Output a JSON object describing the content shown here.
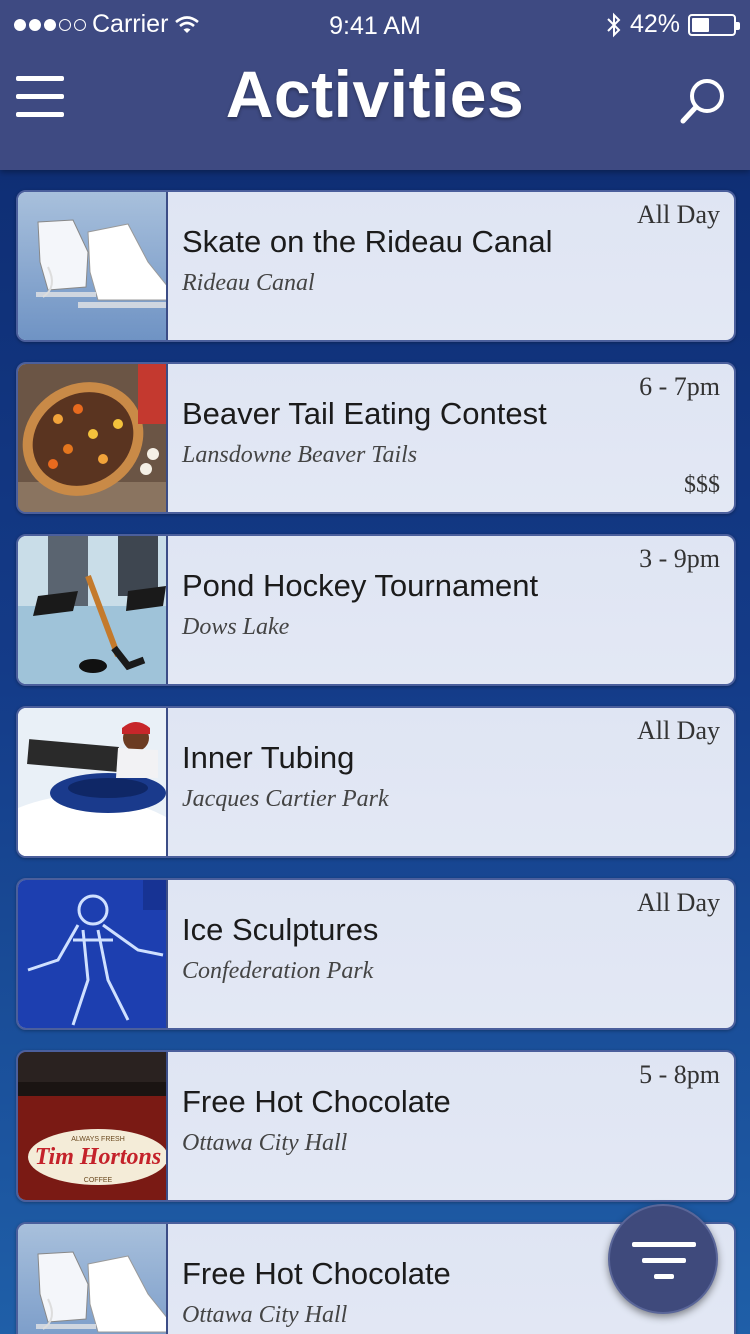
{
  "status_bar": {
    "carrier": "Carrier",
    "time": "9:41 AM",
    "battery": "42%",
    "battery_level": 0.42
  },
  "header": {
    "title": "Activities",
    "menu_icon": "hamburger-menu-icon",
    "search_icon": "search-icon"
  },
  "activities": [
    {
      "title": "Skate on the Rideau Canal",
      "venue": "Rideau Canal",
      "time": "All Day",
      "price": "",
      "image": "ice-skates-image"
    },
    {
      "title": "Beaver Tail Eating Contest",
      "venue": "Lansdowne Beaver Tails",
      "time": "6 - 7pm",
      "price": "$$$",
      "image": "beaver-tail-pastry-image"
    },
    {
      "title": "Pond Hockey Tournament",
      "venue": "Dows Lake",
      "time": "3 - 9pm",
      "price": "",
      "image": "pond-hockey-image"
    },
    {
      "title": "Inner Tubing",
      "venue": "Jacques Cartier Park",
      "time": "All Day",
      "price": "",
      "image": "snow-tubing-image"
    },
    {
      "title": "Ice Sculptures",
      "venue": "Confederation Park",
      "time": "All Day",
      "price": "",
      "image": "ice-sculpture-image"
    },
    {
      "title": "Free Hot Chocolate",
      "venue": "Ottawa City Hall",
      "time": "5 - 8pm",
      "price": "",
      "image": "tim-hortons-cup-image"
    },
    {
      "title": "Free Hot Chocolate",
      "venue": "Ottawa City Hall",
      "time": "",
      "price": "",
      "image": "ice-skates-image"
    }
  ],
  "thumb_text": {
    "tim_hortons": "Tim Hortons",
    "always_fresh": "ALWAYS FRESH",
    "coffee": "COFFEE"
  },
  "filter_button": {
    "icon": "filter-icon"
  },
  "colors": {
    "header": "#3e4a82",
    "card_border": "#4b5f9c",
    "background_top": "#0d2a6e",
    "background_bottom": "#1f5fa8"
  }
}
